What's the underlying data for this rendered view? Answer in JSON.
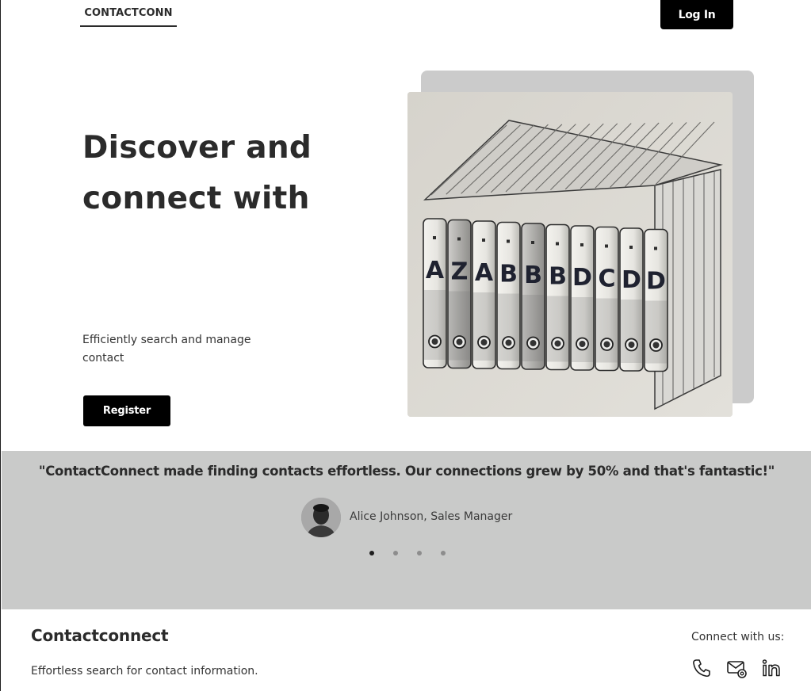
{
  "header": {
    "brand": "CONTACTCONN",
    "login_label": "Log In"
  },
  "hero": {
    "title": "Discover and connect with",
    "subtitle": "Efficiently search and manage contact",
    "register_label": "Register",
    "image_alt": "binders-icon",
    "binder_letters": [
      "A",
      "Z",
      "A",
      "B",
      "B",
      "B",
      "D",
      "C",
      "D",
      "D"
    ]
  },
  "testimonial": {
    "quote": "\"ContactConnect made finding contacts effortless. Our connections grew by 50% and that's fantastic!\"",
    "author": "Alice Johnson, Sales Manager",
    "slide_count": 4,
    "active_slide": 1
  },
  "footer": {
    "title": "Contactconnect",
    "tagline": "Effortless search for contact information.",
    "connect_label": "Connect with us:",
    "icons": [
      "phone-icon",
      "mail-icon",
      "linkedin-icon"
    ]
  },
  "colors": {
    "accent": "#000000",
    "testimonial_bg": "#c9cac9",
    "text": "#2b2b2b"
  }
}
